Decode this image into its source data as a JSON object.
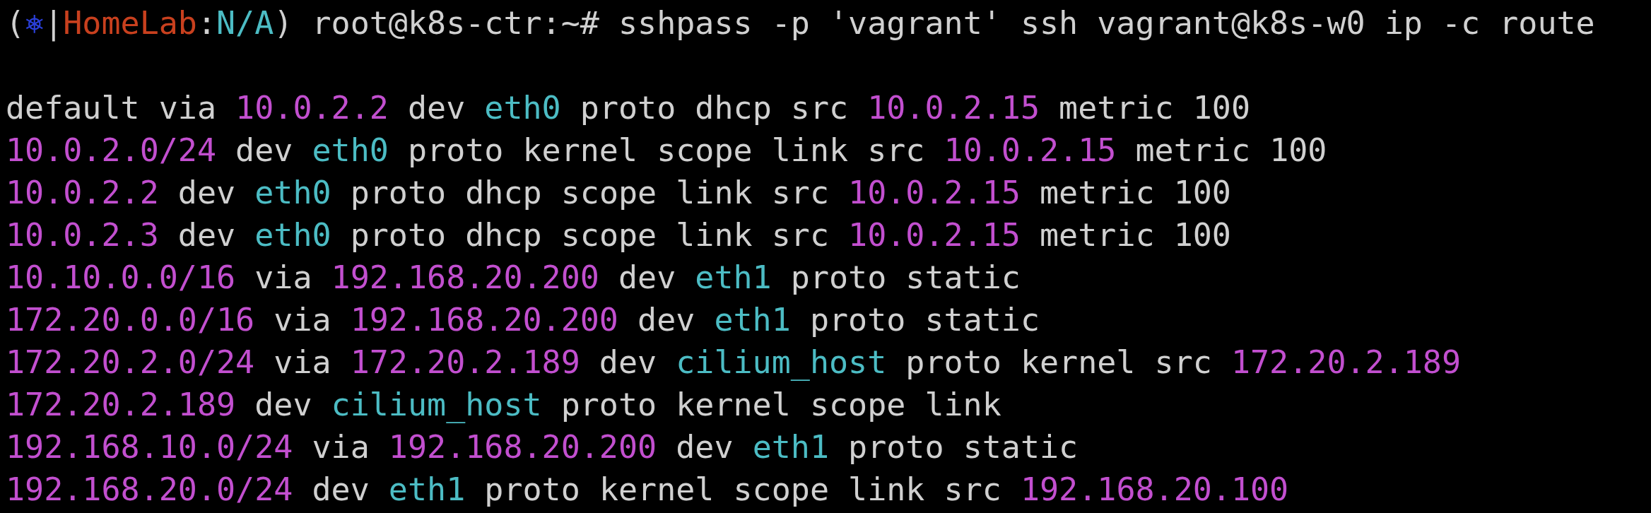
{
  "prompt": {
    "segments": [
      {
        "text": "(",
        "kind": "plain"
      },
      {
        "text": "⎈",
        "kind": "symbol"
      },
      {
        "text": "|",
        "kind": "plain"
      },
      {
        "text": "HomeLab",
        "kind": "context"
      },
      {
        "text": ":",
        "kind": "plain"
      },
      {
        "text": "N/A",
        "kind": "namespace"
      },
      {
        "text": ") root@k8s-ctr:~# sshpass -p 'vagrant' ssh vagrant@k8s-w0 ip -c route",
        "kind": "plain"
      }
    ]
  },
  "output": [
    {
      "segments": [
        {
          "text": "default via ",
          "kind": "plain"
        },
        {
          "text": "10.0.2.2",
          "kind": "address"
        },
        {
          "text": " dev ",
          "kind": "plain"
        },
        {
          "text": "eth0",
          "kind": "interface"
        },
        {
          "text": " proto dhcp src ",
          "kind": "plain"
        },
        {
          "text": "10.0.2.15",
          "kind": "address"
        },
        {
          "text": " metric 100",
          "kind": "plain"
        }
      ]
    },
    {
      "segments": [
        {
          "text": "10.0.2.0/24",
          "kind": "address"
        },
        {
          "text": " dev ",
          "kind": "plain"
        },
        {
          "text": "eth0",
          "kind": "interface"
        },
        {
          "text": " proto kernel scope link src ",
          "kind": "plain"
        },
        {
          "text": "10.0.2.15",
          "kind": "address"
        },
        {
          "text": " metric 100",
          "kind": "plain"
        }
      ]
    },
    {
      "segments": [
        {
          "text": "10.0.2.2",
          "kind": "address"
        },
        {
          "text": " dev ",
          "kind": "plain"
        },
        {
          "text": "eth0",
          "kind": "interface"
        },
        {
          "text": " proto dhcp scope link src ",
          "kind": "plain"
        },
        {
          "text": "10.0.2.15",
          "kind": "address"
        },
        {
          "text": " metric 100",
          "kind": "plain"
        }
      ]
    },
    {
      "segments": [
        {
          "text": "10.0.2.3",
          "kind": "address"
        },
        {
          "text": " dev ",
          "kind": "plain"
        },
        {
          "text": "eth0",
          "kind": "interface"
        },
        {
          "text": " proto dhcp scope link src ",
          "kind": "plain"
        },
        {
          "text": "10.0.2.15",
          "kind": "address"
        },
        {
          "text": " metric 100",
          "kind": "plain"
        }
      ]
    },
    {
      "segments": [
        {
          "text": "10.10.0.0/16",
          "kind": "address"
        },
        {
          "text": " via ",
          "kind": "plain"
        },
        {
          "text": "192.168.20.200",
          "kind": "address"
        },
        {
          "text": " dev ",
          "kind": "plain"
        },
        {
          "text": "eth1",
          "kind": "interface"
        },
        {
          "text": " proto static",
          "kind": "plain"
        }
      ]
    },
    {
      "segments": [
        {
          "text": "172.20.0.0/16",
          "kind": "address"
        },
        {
          "text": " via ",
          "kind": "plain"
        },
        {
          "text": "192.168.20.200",
          "kind": "address"
        },
        {
          "text": " dev ",
          "kind": "plain"
        },
        {
          "text": "eth1",
          "kind": "interface"
        },
        {
          "text": " proto static",
          "kind": "plain"
        }
      ]
    },
    {
      "segments": [
        {
          "text": "172.20.2.0/24",
          "kind": "address"
        },
        {
          "text": " via ",
          "kind": "plain"
        },
        {
          "text": "172.20.2.189",
          "kind": "address"
        },
        {
          "text": " dev ",
          "kind": "plain"
        },
        {
          "text": "cilium_host",
          "kind": "interface"
        },
        {
          "text": " proto kernel src ",
          "kind": "plain"
        },
        {
          "text": "172.20.2.189",
          "kind": "address"
        }
      ]
    },
    {
      "segments": [
        {
          "text": "172.20.2.189",
          "kind": "address"
        },
        {
          "text": " dev ",
          "kind": "plain"
        },
        {
          "text": "cilium_host",
          "kind": "interface"
        },
        {
          "text": " proto kernel scope link",
          "kind": "plain"
        }
      ]
    },
    {
      "segments": [
        {
          "text": "192.168.10.0/24",
          "kind": "address"
        },
        {
          "text": " via ",
          "kind": "plain"
        },
        {
          "text": "192.168.20.200",
          "kind": "address"
        },
        {
          "text": " dev ",
          "kind": "plain"
        },
        {
          "text": "eth1",
          "kind": "interface"
        },
        {
          "text": " proto static",
          "kind": "plain"
        }
      ]
    },
    {
      "segments": [
        {
          "text": "192.168.20.0/24",
          "kind": "address"
        },
        {
          "text": " dev ",
          "kind": "plain"
        },
        {
          "text": "eth1",
          "kind": "interface"
        },
        {
          "text": " proto kernel scope link src ",
          "kind": "plain"
        },
        {
          "text": "192.168.20.100",
          "kind": "address"
        }
      ]
    }
  ]
}
